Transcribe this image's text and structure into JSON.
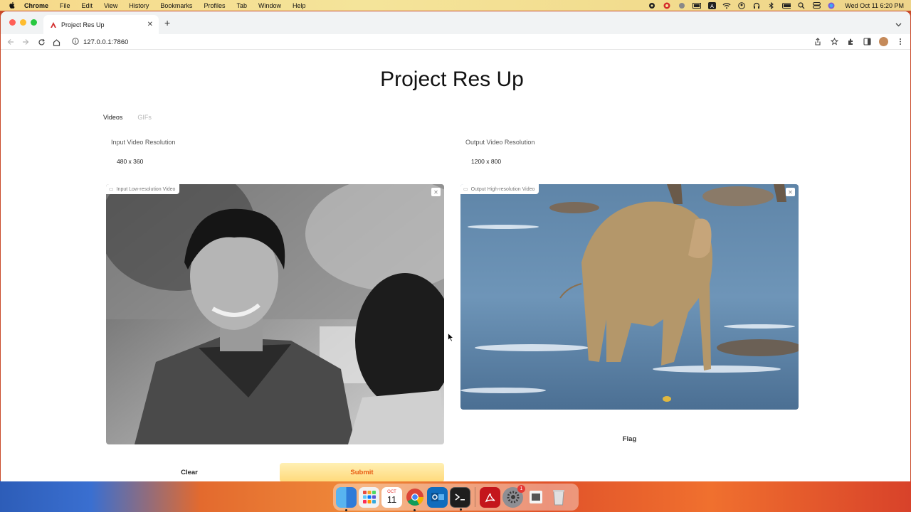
{
  "menubar": {
    "app": "Chrome",
    "items": [
      "File",
      "Edit",
      "View",
      "History",
      "Bookmarks",
      "Profiles",
      "Tab",
      "Window",
      "Help"
    ],
    "clock": "Wed Oct 11  6:20 PM",
    "status_icons": [
      "camera-icon",
      "creative-cloud-icon",
      "globe-icon",
      "battery-meter-icon",
      "input-source-icon",
      "wifi-icon",
      "user-icon",
      "headphones-icon",
      "bluetooth-icon",
      "battery-icon",
      "search-icon",
      "control-center-icon",
      "siri-icon"
    ]
  },
  "browser": {
    "tab_title": "Project Res Up",
    "url": "127.0.0.1:7860"
  },
  "page": {
    "title": "Project Res Up",
    "tabs": [
      {
        "label": "Videos",
        "active": true
      },
      {
        "label": "GIFs",
        "active": false
      }
    ],
    "input_resolution": {
      "label": "Input Video Resolution",
      "value": "480 x 360"
    },
    "output_resolution": {
      "label": "Output Video Resolution",
      "value": "1200 x 800"
    },
    "input_video": {
      "label": "Input Low-resolution Video"
    },
    "output_video": {
      "label": "Output High-resolution Video"
    },
    "buttons": {
      "clear": "Clear",
      "submit": "Submit",
      "flag": "Flag"
    }
  },
  "dock": {
    "calendar_month": "OCT",
    "calendar_day": "11",
    "settings_badge": "1",
    "apps": [
      "finder-icon",
      "launchpad-icon",
      "calendar-icon",
      "chrome-icon",
      "outlook-icon",
      "terminal-icon",
      "acrobat-icon",
      "system-settings-icon",
      "preview-icon",
      "trash-icon"
    ]
  },
  "colors": {
    "submit_text": "#e85a10",
    "submit_bg": "#ffd97a"
  }
}
